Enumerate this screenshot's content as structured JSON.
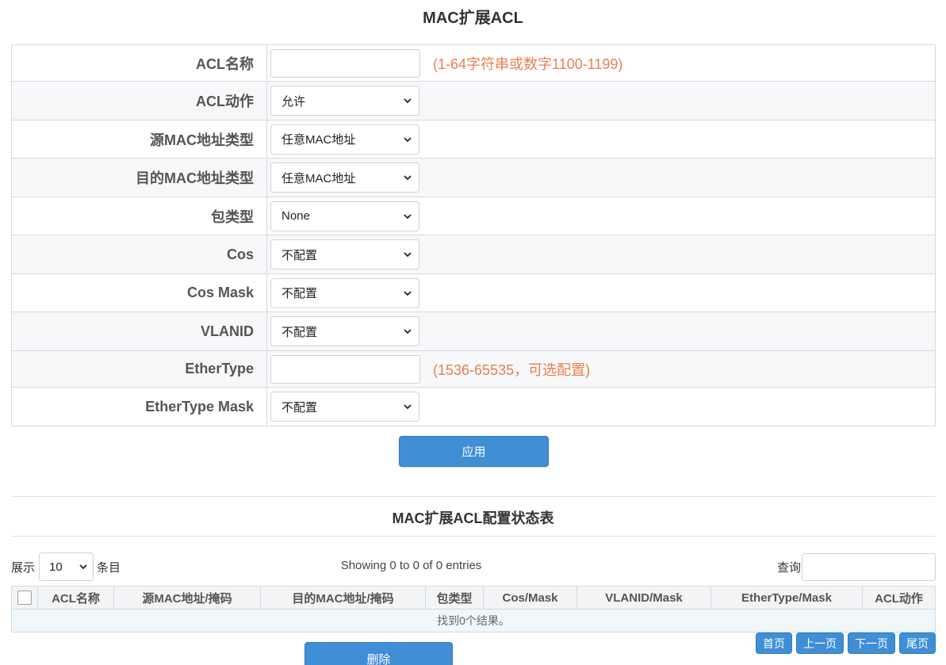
{
  "form": {
    "title": "MAC扩展ACL",
    "rows": {
      "acl_name": {
        "label": "ACL名称",
        "value": "",
        "hint": "(1-64字符串或数字1100-1199)"
      },
      "acl_action": {
        "label": "ACL动作",
        "selected": "允许"
      },
      "src_mac_type": {
        "label": "源MAC地址类型",
        "selected": "任意MAC地址"
      },
      "dst_mac_type": {
        "label": "目的MAC地址类型",
        "selected": "任意MAC地址"
      },
      "packet_type": {
        "label": "包类型",
        "selected": "None"
      },
      "cos": {
        "label": "Cos",
        "selected": "不配置"
      },
      "cos_mask": {
        "label": "Cos Mask",
        "selected": "不配置"
      },
      "vlanid": {
        "label": "VLANID",
        "selected": "不配置"
      },
      "ethertype": {
        "label": "EtherType",
        "value": "",
        "hint": "(1536-65535，可选配置)"
      },
      "ethertype_mask": {
        "label": "EtherType Mask",
        "selected": "不配置"
      }
    },
    "apply_label": "应用"
  },
  "status_table": {
    "title": "MAC扩展ACL配置状态表",
    "length_prefix": "展示",
    "length_value": "10",
    "length_suffix": "条目",
    "info": "Showing 0 to 0 of 0 entries",
    "search_label": "查询",
    "search_value": "",
    "columns": [
      "ACL名称",
      "源MAC地址/掩码",
      "目的MAC地址/掩码",
      "包类型",
      "Cos/Mask",
      "VLANID/Mask",
      "EtherType/Mask",
      "ACL动作"
    ],
    "empty_message": "找到0个结果。",
    "pager": {
      "first": "首页",
      "prev": "上一页",
      "next": "下一页",
      "last": "尾页"
    },
    "delete_label": "删除"
  },
  "colors": {
    "accent": "#3f8ed6",
    "hint": "#e8814f",
    "empty_row_bg": "#eef8fb"
  }
}
